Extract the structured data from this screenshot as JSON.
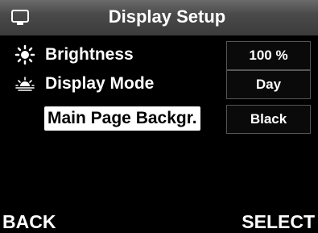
{
  "header": {
    "title": "Display Setup",
    "icon": "monitor-icon"
  },
  "rows": [
    {
      "label": "Brightness",
      "value": "100 %",
      "icon": "sun-icon"
    },
    {
      "label": "Display Mode",
      "value": "Day",
      "icon": "day-night-icon"
    },
    {
      "label": "Main Page Backgr.",
      "value": "Black",
      "icon": "",
      "selected": true
    }
  ],
  "footer": {
    "back_label": "BACK",
    "select_label": "SELECT"
  },
  "colors": {
    "background": "#000000",
    "header": "#4a4a4a",
    "selection": "#ffffff",
    "text": "#ffffff"
  }
}
